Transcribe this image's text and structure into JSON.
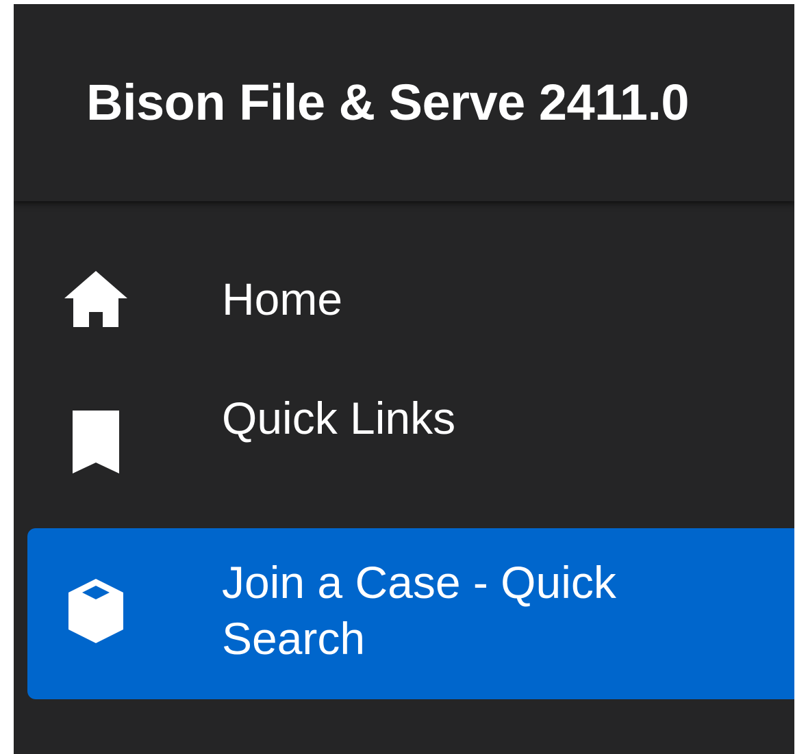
{
  "app": {
    "title": "Bison File & Serve 2411.0"
  },
  "sidebar": {
    "items": [
      {
        "label": "Home",
        "icon": "home-icon",
        "active": false
      },
      {
        "label": "Quick Links",
        "icon": "bookmark-icon",
        "active": false
      },
      {
        "label": "Join a Case - Quick Search",
        "icon": "box-icon",
        "active": true
      }
    ]
  },
  "colors": {
    "background": "#252526",
    "active_item": "#0066cc",
    "text": "#ffffff"
  }
}
